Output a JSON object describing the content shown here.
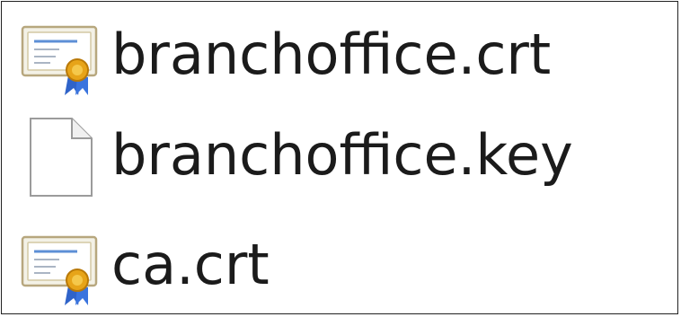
{
  "files": [
    {
      "name": "branchoffice.crt",
      "icon": "certificate-icon"
    },
    {
      "name": "branchoffice.key",
      "icon": "blank-file-icon"
    },
    {
      "name": "ca.crt",
      "icon": "certificate-icon"
    }
  ]
}
